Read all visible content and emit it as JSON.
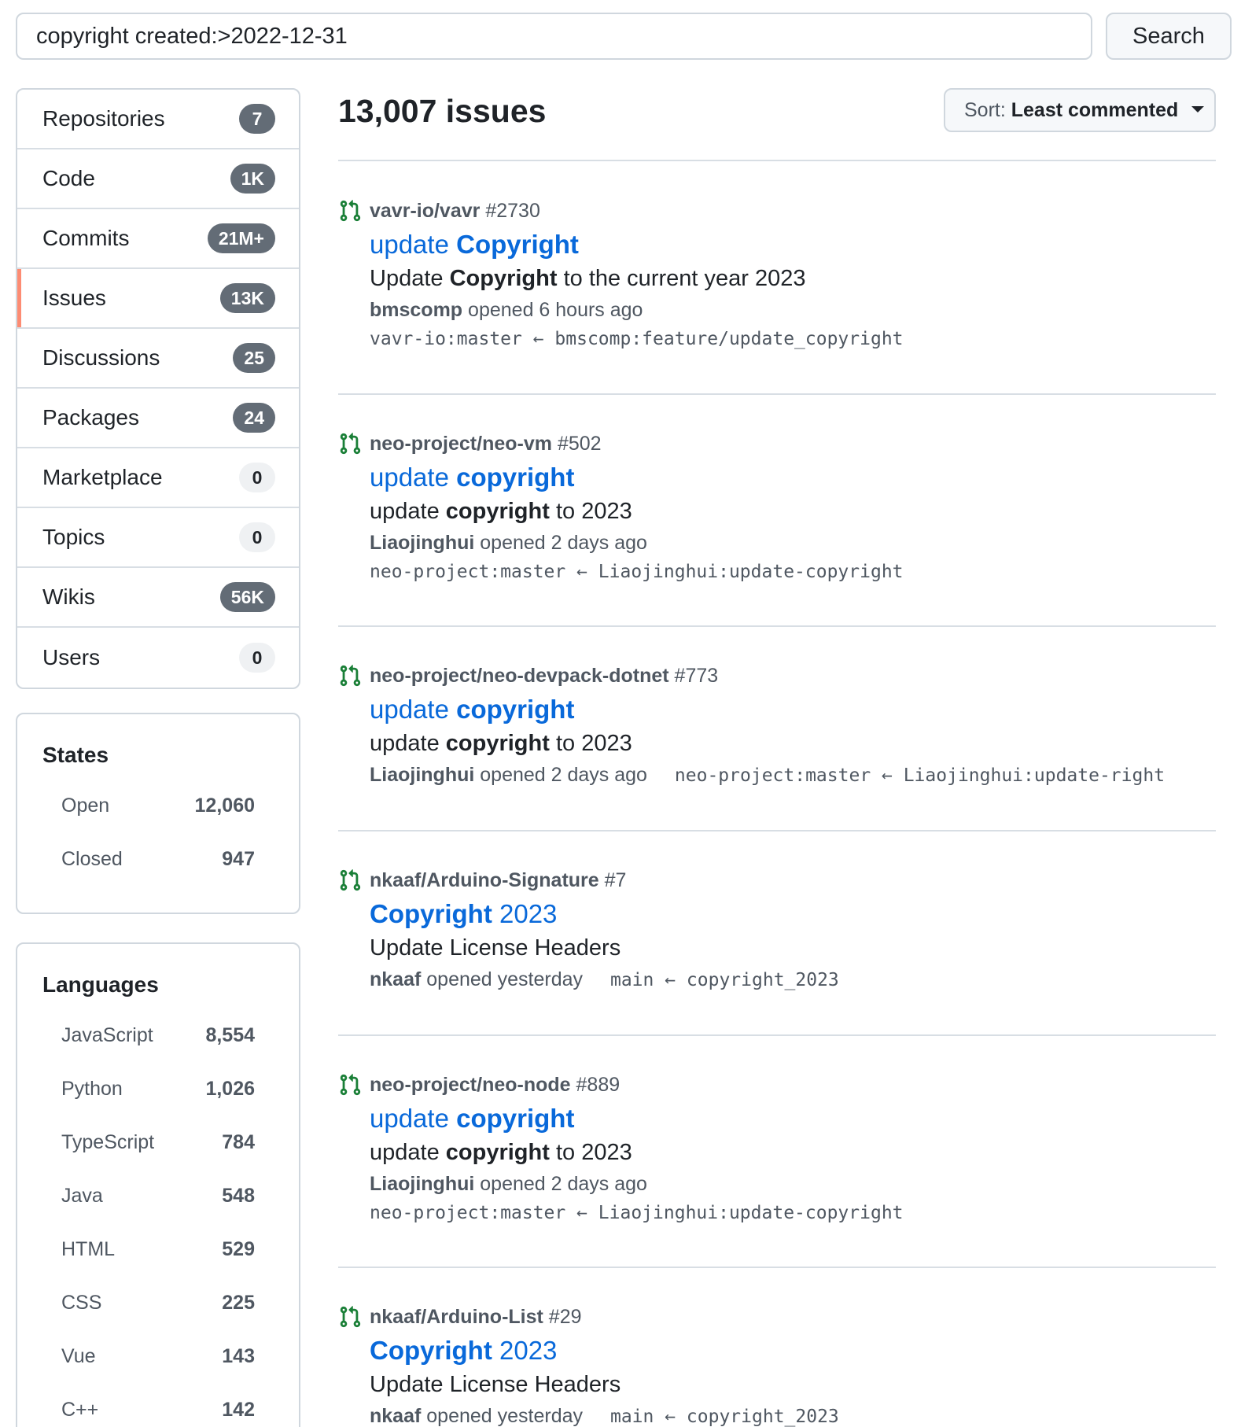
{
  "search": {
    "query": "copyright created:>2022-12-31",
    "button_label": "Search"
  },
  "nav": {
    "items": [
      {
        "label": "Repositories",
        "count": "7"
      },
      {
        "label": "Code",
        "count": "1K"
      },
      {
        "label": "Commits",
        "count": "21M+"
      },
      {
        "label": "Issues",
        "count": "13K"
      },
      {
        "label": "Discussions",
        "count": "25"
      },
      {
        "label": "Packages",
        "count": "24"
      },
      {
        "label": "Marketplace",
        "count": "0"
      },
      {
        "label": "Topics",
        "count": "0"
      },
      {
        "label": "Wikis",
        "count": "56K"
      },
      {
        "label": "Users",
        "count": "0"
      }
    ],
    "selected": "Issues"
  },
  "states": {
    "title": "States",
    "rows": [
      {
        "name": "Open",
        "count": "12,060"
      },
      {
        "name": "Closed",
        "count": "947"
      }
    ]
  },
  "languages": {
    "title": "Languages",
    "rows": [
      {
        "name": "JavaScript",
        "count": "8,554"
      },
      {
        "name": "Python",
        "count": "1,026"
      },
      {
        "name": "TypeScript",
        "count": "784"
      },
      {
        "name": "Java",
        "count": "548"
      },
      {
        "name": "HTML",
        "count": "529"
      },
      {
        "name": "CSS",
        "count": "225"
      },
      {
        "name": "Vue",
        "count": "143"
      },
      {
        "name": "C++",
        "count": "142"
      }
    ]
  },
  "main": {
    "results_title": "13,007 issues",
    "sort_prefix": "Sort:",
    "sort_value": "Least commented"
  },
  "results": [
    {
      "repo": "vavr-io/vavr",
      "number": "#2730",
      "title_pre": "update ",
      "title_bold": "Copyright",
      "desc_pre": "Update ",
      "desc_bold": "Copyright",
      "desc_post": " to the current year 2023",
      "author": "bmscomp",
      "opened": "opened 6 hours ago",
      "branch": "vavr-io:master ← bmscomp:feature/update_copyright"
    },
    {
      "repo": "neo-project/neo-vm",
      "number": "#502",
      "title_pre": "update ",
      "title_bold": "copyright",
      "desc_pre": "update ",
      "desc_bold": "copyright",
      "desc_post": " to 2023",
      "author": "Liaojinghui",
      "opened": "opened 2 days ago",
      "branch": "neo-project:master ← Liaojinghui:update-copyright"
    },
    {
      "repo": "neo-project/neo-devpack-dotnet",
      "number": "#773",
      "title_pre": "update ",
      "title_bold": "copyright",
      "desc_pre": "update ",
      "desc_bold": "copyright",
      "desc_post": " to 2023",
      "author": "Liaojinghui",
      "opened": "opened 2 days ago",
      "branch": "neo-project:master ← Liaojinghui:update-right"
    },
    {
      "repo": "nkaaf/Arduino-Signature",
      "number": "#7",
      "title_pre": "",
      "title_bold": "Copyright",
      "title_post": " 2023",
      "desc_pre": "Update License Headers",
      "desc_bold": "",
      "desc_post": "",
      "author": "nkaaf",
      "opened": "opened yesterday",
      "branch": "main ← copyright_2023"
    },
    {
      "repo": "neo-project/neo-node",
      "number": "#889",
      "title_pre": "update ",
      "title_bold": "copyright",
      "desc_pre": "update ",
      "desc_bold": "copyright",
      "desc_post": " to 2023",
      "author": "Liaojinghui",
      "opened": "opened 2 days ago",
      "branch": "neo-project:master ← Liaojinghui:update-copyright"
    },
    {
      "repo": "nkaaf/Arduino-List",
      "number": "#29",
      "title_pre": "",
      "title_bold": "Copyright",
      "title_post": " 2023",
      "desc_pre": "Update License Headers",
      "desc_bold": "",
      "desc_post": "",
      "author": "nkaaf",
      "opened": "opened yesterday",
      "branch": "main ← copyright_2023"
    }
  ],
  "colors": {
    "accent_link": "#0969da",
    "pr_open_icon": "#1a7f37",
    "selected_nav_marker": "#fd8c73"
  },
  "icons": {
    "pr": "git-pull-request-icon",
    "sort_caret": "triangle-down-icon"
  }
}
